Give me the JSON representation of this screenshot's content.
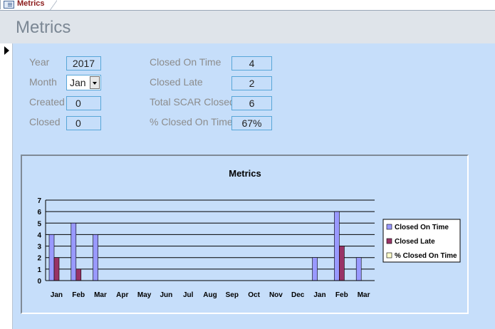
{
  "tab": {
    "label": "Metrics"
  },
  "header": {
    "title": "Metrics"
  },
  "form": {
    "year": {
      "label": "Year",
      "value": "2017"
    },
    "month": {
      "label": "Month",
      "value": "Jan"
    },
    "created": {
      "label": "Created",
      "value": "0"
    },
    "closed": {
      "label": "Closed",
      "value": "0"
    },
    "closed_on_time": {
      "label": "Closed On Time",
      "value": "4"
    },
    "closed_late": {
      "label": "Closed Late",
      "value": "2"
    },
    "total_scar_closed": {
      "label": "Total SCAR Closed",
      "value": "6"
    },
    "pct_closed_on_time": {
      "label": "% Closed On Time",
      "value": "67%"
    }
  },
  "colors": {
    "closed_on_time": "#9999ff",
    "closed_late": "#993366",
    "pct_closed_on_time": "#ffffcc"
  },
  "chart_data": {
    "type": "bar",
    "title": "Metrics",
    "categories": [
      "Jan",
      "Feb",
      "Mar",
      "Apr",
      "May",
      "Jun",
      "Jul",
      "Aug",
      "Sep",
      "Oct",
      "Nov",
      "Dec",
      "Jan",
      "Feb",
      "Mar"
    ],
    "series": [
      {
        "name": "Closed On Time",
        "values": [
          4,
          5,
          4,
          0,
          0,
          0,
          0,
          0,
          0,
          0,
          0,
          0,
          2,
          6,
          2
        ]
      },
      {
        "name": "Closed Late",
        "values": [
          2,
          1,
          0,
          0,
          0,
          0,
          0,
          0,
          0,
          0,
          0,
          0,
          0,
          3,
          0
        ]
      },
      {
        "name": "% Closed On Time",
        "values": [
          0,
          0,
          0,
          0,
          0,
          0,
          0,
          0,
          0,
          0,
          0,
          0,
          0,
          0,
          0
        ]
      }
    ],
    "yticks": [
      "0",
      "1",
      "2",
      "3",
      "4",
      "5",
      "6",
      "7"
    ],
    "ylim": [
      0,
      7
    ],
    "grid": true,
    "legend": "right"
  }
}
